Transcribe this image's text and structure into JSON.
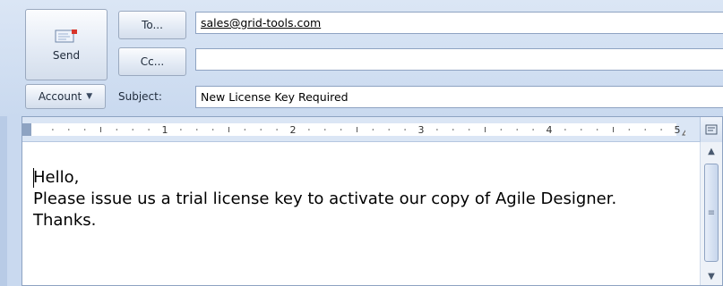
{
  "header": {
    "send_label": "Send",
    "to_label": "To...",
    "cc_label": "Cc...",
    "account_label": "Account",
    "account_arrow": "▼",
    "subject_label": "Subject:"
  },
  "fields": {
    "to_value": "sales@grid-tools.com",
    "cc_value": "",
    "subject_value": "New License Key Required"
  },
  "ruler": {
    "numbers": [
      "1",
      "2",
      "3",
      "4",
      "5"
    ]
  },
  "body": {
    "line1": "Hello,",
    "line2": "Please issue us a trial license key to activate our copy of Agile Designer.",
    "line3": "Thanks."
  },
  "scrollbar": {
    "up_glyph": "▲",
    "down_glyph": "▼",
    "grip_glyph": "≡"
  },
  "icons": {
    "send": "envelope-icon",
    "ruler_toggle": "ruler-toggle-icon"
  },
  "colors": {
    "chrome": "#c9d9ef",
    "field_border": "#8ea3c2",
    "button_border": "#9aa9bf"
  }
}
